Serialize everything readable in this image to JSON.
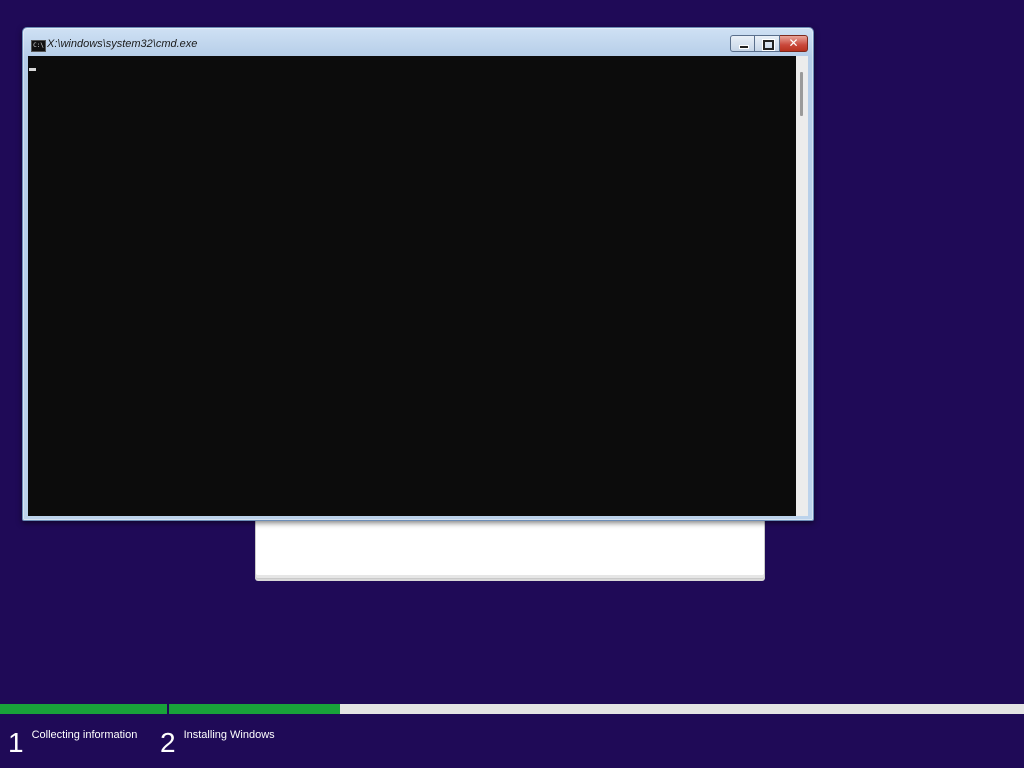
{
  "window": {
    "title": "X:\\windows\\system32\\cmd.exe",
    "icon": "console-icon",
    "icon_text": "C:\\",
    "buttons": {
      "minimize_icon": "minimize-icon",
      "maximize_icon": "maximize-icon",
      "close_icon": "close-icon",
      "close_glyph": "✕"
    }
  },
  "console": {
    "text": ""
  },
  "progress": {
    "segments": [
      {
        "label": "Collecting information",
        "fraction": 1.0
      },
      {
        "label": "Installing Windows",
        "fraction": 0.2
      }
    ]
  },
  "steps": [
    {
      "number": "1",
      "label": "Collecting information"
    },
    {
      "number": "2",
      "label": "Installing Windows"
    }
  ],
  "colors": {
    "background": "#1f0a57",
    "progress_fill": "#19a23a",
    "progress_track": "#e4e4e4",
    "console_bg": "#0c0c0c"
  }
}
